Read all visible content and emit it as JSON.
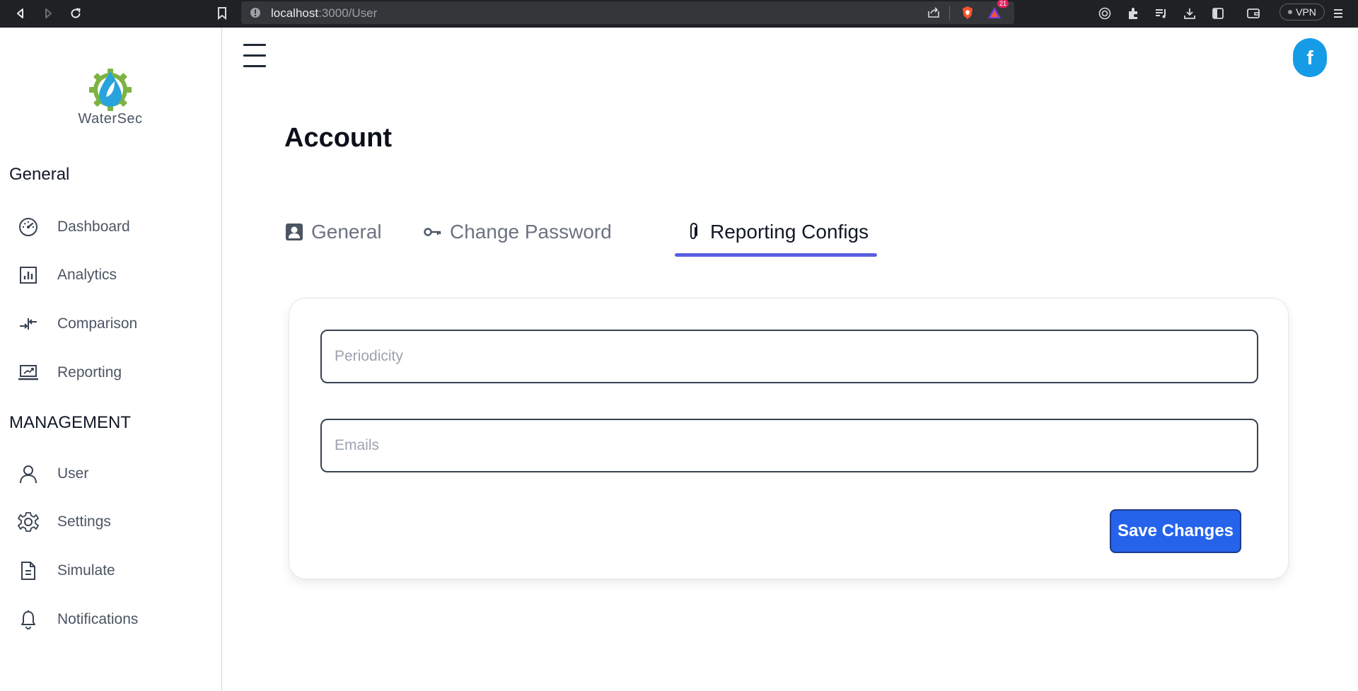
{
  "browser": {
    "url_host": "localhost",
    "url_path": ":3000/User",
    "notification_badge": "21",
    "vpn_label": "VPN"
  },
  "sidebar": {
    "logo_text": "WaterSec",
    "sections": [
      {
        "title": "General",
        "items": [
          {
            "label": "Dashboard",
            "icon": "dashboard-gauge-icon"
          },
          {
            "label": "Analytics",
            "icon": "analytics-chart-icon"
          },
          {
            "label": "Comparison",
            "icon": "comparison-arrows-icon"
          },
          {
            "label": "Reporting",
            "icon": "reporting-laptop-icon"
          }
        ]
      },
      {
        "title": "MANAGEMENT",
        "items": [
          {
            "label": "User",
            "icon": "user-icon"
          },
          {
            "label": "Settings",
            "icon": "gear-icon"
          },
          {
            "label": "Simulate",
            "icon": "document-icon"
          },
          {
            "label": "Notifications",
            "icon": "bell-icon"
          }
        ]
      }
    ]
  },
  "header": {
    "avatar_initial": "f"
  },
  "main": {
    "title": "Account",
    "tabs": [
      {
        "label": "General",
        "icon": "profile-card-icon",
        "active": false
      },
      {
        "label": "Change Password",
        "icon": "key-icon",
        "active": false
      },
      {
        "label": "Reporting Configs",
        "icon": "paperclip-icon",
        "active": true
      }
    ],
    "form": {
      "periodicity": {
        "placeholder": "Periodicity",
        "value": ""
      },
      "emails": {
        "placeholder": "Emails",
        "value": ""
      },
      "save_label": "Save Changes"
    }
  },
  "colors": {
    "accent_tab": "#5a5fe0",
    "save_button": "#2563eb",
    "avatar": "#169ce6"
  }
}
